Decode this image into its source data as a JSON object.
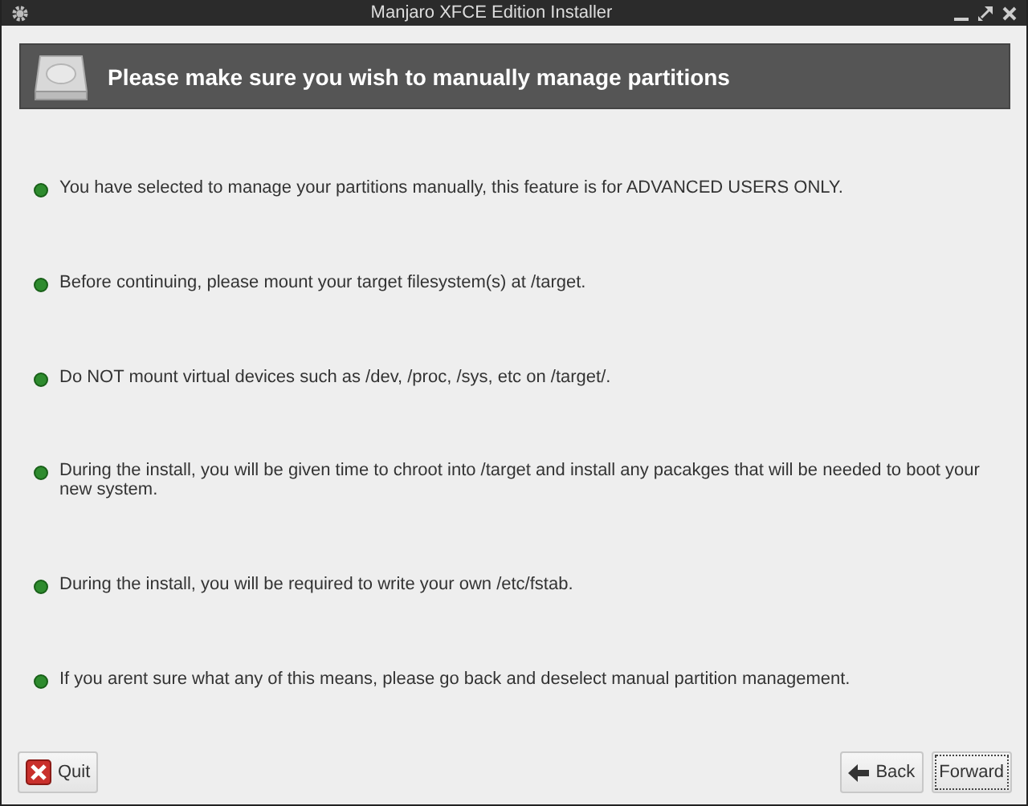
{
  "window": {
    "title": "Manjaro XFCE Edition Installer"
  },
  "header": {
    "title": "Please make sure you wish to manually manage partitions"
  },
  "notes": [
    "You have selected to manage your partitions manually, this feature is for ADVANCED USERS ONLY.",
    "Before continuing, please mount your target filesystem(s) at /target.",
    "Do NOT mount virtual devices such as /dev, /proc, /sys, etc on /target/.",
    "During the install, you will be given time to chroot into /target and install any pacakges that will be needed to boot your new system.",
    "During the install, you will be required to write your own /etc/fstab.",
    "If you arent sure what any of this means, please go back and deselect manual partition management."
  ],
  "buttons": [
    {
      "kind": "quit",
      "label": "Quit",
      "focused": false
    },
    {
      "kind": "back",
      "label": "Back",
      "focused": false
    },
    {
      "kind": "forward",
      "label": "Forward",
      "focused": true
    }
  ]
}
